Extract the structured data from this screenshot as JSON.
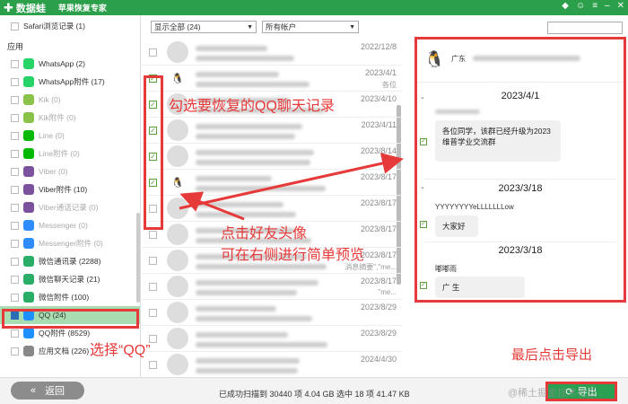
{
  "titlebar": {
    "app_name": "数据蛙",
    "subtitle": "苹果恢复专家",
    "icons": [
      "gem-icon",
      "user-icon",
      "menu-icon",
      "minimize-icon",
      "close-icon"
    ]
  },
  "sidebar": {
    "top_item": "Safari浏览记录 (1)",
    "section_label": "应用",
    "items": [
      {
        "label": "WhatsApp (2)",
        "color": "#25d366",
        "dim": false
      },
      {
        "label": "WhatsApp附件 (17)",
        "color": "#25d366",
        "dim": false
      },
      {
        "label": "Kik (0)",
        "color": "#8bc34a",
        "dim": true
      },
      {
        "label": "Kik附件 (0)",
        "color": "#8bc34a",
        "dim": true
      },
      {
        "label": "Line (0)",
        "color": "#00b900",
        "dim": true
      },
      {
        "label": "Line附件 (0)",
        "color": "#00b900",
        "dim": true
      },
      {
        "label": "Viber (0)",
        "color": "#7c529e",
        "dim": true
      },
      {
        "label": "Viber附件 (10)",
        "color": "#7c529e",
        "dim": false
      },
      {
        "label": "Viber通话记录 (0)",
        "color": "#7c529e",
        "dim": true
      },
      {
        "label": "Messenger (0)",
        "color": "#2f8cff",
        "dim": true
      },
      {
        "label": "Messenger附件 (0)",
        "color": "#2f8cff",
        "dim": true
      },
      {
        "label": "微信通讯录 (2288)",
        "color": "#2aae67",
        "dim": false
      },
      {
        "label": "微信聊天记录 (21)",
        "color": "#2aae67",
        "dim": false
      },
      {
        "label": "微信附件 (100)",
        "color": "#2aae67",
        "dim": false
      },
      {
        "label": "QQ (24)",
        "color": "#1e90ff",
        "dim": false,
        "selected": true
      },
      {
        "label": "QQ附件 (8529)",
        "color": "#1e90ff",
        "dim": false
      },
      {
        "label": "应用文档 (226)",
        "color": "#888888",
        "dim": false
      }
    ]
  },
  "filters": {
    "show_all": "显示全部 (24)",
    "accounts": "所有帐户"
  },
  "list": {
    "rows": [
      {
        "date": "2022/12/8",
        "snippet": "",
        "checked": false,
        "penguin": false
      },
      {
        "date": "2023/4/1",
        "snippet": "各位",
        "checked": true,
        "penguin": true
      },
      {
        "date": "2023/4/10",
        "snippet": "",
        "checked": true,
        "penguin": false
      },
      {
        "date": "2023/4/11",
        "snippet": "",
        "checked": true,
        "penguin": false
      },
      {
        "date": "2023/8/14",
        "snippet": "",
        "checked": true,
        "penguin": false
      },
      {
        "date": "2023/8/17",
        "snippet": "",
        "checked": true,
        "penguin": true
      },
      {
        "date": "2023/8/17",
        "snippet": "",
        "checked": false,
        "penguin": false
      },
      {
        "date": "2023/8/17",
        "snippet": "",
        "checked": false,
        "penguin": false
      },
      {
        "date": "2023/8/17",
        "snippet": "消息摘要\",\"me...",
        "checked": false,
        "penguin": false
      },
      {
        "date": "2023/8/17",
        "snippet": "\"me...",
        "checked": false,
        "penguin": false
      },
      {
        "date": "2023/8/29",
        "snippet": "",
        "checked": false,
        "penguin": false
      },
      {
        "date": "2023/8/29",
        "snippet": "",
        "checked": false,
        "penguin": false
      },
      {
        "date": "2024/4/30",
        "snippet": "",
        "checked": false,
        "penguin": false
      }
    ]
  },
  "preview": {
    "search_placeholder": "",
    "header_name": "广东",
    "groups": [
      {
        "date": "2023/4/1",
        "sender": "",
        "message": "各位同学，该群已经升级为2023维普学业交流群"
      },
      {
        "date": "2023/3/18",
        "sender": "YYYYYYYYeLLLLLLLow",
        "message": "大家好"
      },
      {
        "date": "2023/3/18",
        "sender": "嘟嘟雨",
        "message": "广 生"
      }
    ]
  },
  "footer": {
    "back_label": "返回",
    "status": "已成功扫描到 30440 项 4.04 GB    选中 18 项 41.47 KB",
    "export_label": "导出",
    "watermark": "@稀土掘金技术社区"
  },
  "annotations": {
    "tick_qq": "勾选要恢复的QQ聊天记录",
    "click_avatar_1": "点击好友头像",
    "click_avatar_2": "可在右侧进行简单预览",
    "select_qq": "选择“QQ”",
    "export_last": "最后点击导出"
  }
}
